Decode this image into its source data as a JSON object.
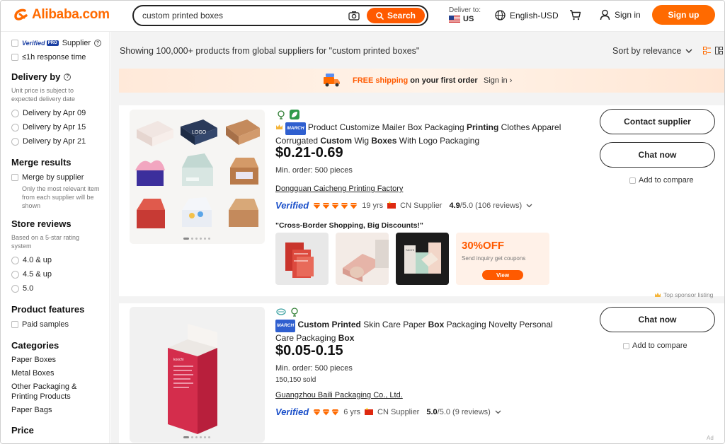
{
  "header": {
    "logo_text": "Alibaba.com",
    "search_value": "custom printed boxes",
    "search_button": "Search",
    "deliver_label": "Deliver to:",
    "deliver_country": "US",
    "language": "English-USD",
    "signin": "Sign in",
    "signup": "Sign up"
  },
  "sidebar": {
    "verified_pro_label": "Verified",
    "verified_pro_badge": "PRO",
    "verified_pro_text": "Supplier",
    "response_time": "≤1h response time",
    "delivery_title": "Delivery by",
    "delivery_note": "Unit price is subject to expected delivery date",
    "delivery_options": [
      "Delivery by Apr 09",
      "Delivery by Apr 15",
      "Delivery by Apr 21"
    ],
    "merge_title": "Merge results",
    "merge_option": "Merge by supplier",
    "merge_note": "Only the most relevant item from each supplier will be shown",
    "reviews_title": "Store reviews",
    "reviews_note": "Based on a 5-star rating system",
    "review_options": [
      "4.0 & up",
      "4.5 & up",
      "5.0"
    ],
    "features_title": "Product features",
    "features_option": "Paid samples",
    "categories_title": "Categories",
    "categories": [
      "Paper Boxes",
      "Metal Boxes",
      "Other Packaging & Printing Products",
      "Paper Bags"
    ],
    "price_title": "Price"
  },
  "main": {
    "results_text": "Showing 100,000+ products from global suppliers for \"custom printed boxes\"",
    "sort_label": "Sort by relevance",
    "banner_free": "FREE shipping",
    "banner_rest": " on your first order",
    "banner_signin": "Sign in ›",
    "sponsor_label": "Top sponsor listing",
    "ad_label": "Ad"
  },
  "products": [
    {
      "march": "MARCH",
      "title_parts": [
        " Product Customize Mailer Box Packaging ",
        "Printing",
        " Clothes Apparel Corrugated ",
        "Custom",
        " Wig ",
        "Boxes",
        " With Logo Packaging"
      ],
      "price": "$0.21-0.69",
      "moq": "Min. order: 500 pieces",
      "supplier": "Dongguan Caicheng Printing Factory",
      "verified": "Verified",
      "years": "19 yrs",
      "country": "CN Supplier",
      "rating": "4.9",
      "rating_rest": "/5.0 (106 reviews)",
      "tagline": "\"Cross-Border Shopping, Big Discounts!\"",
      "coupon_pct": "30%OFF",
      "coupon_note": "Send inquiry get coupons",
      "coupon_btn": "View",
      "btn_contact": "Contact supplier",
      "btn_chat": "Chat now",
      "compare": "Add to compare",
      "diamonds": 5
    },
    {
      "march": "MARCH",
      "title_bold1": "Custom Printed",
      "title_mid": " Skin Care Paper ",
      "title_bold2": "Box",
      "title_mid2": " Packaging Novelty Personal Care Packaging ",
      "title_bold3": "Box",
      "price": "$0.05-0.15",
      "moq": "Min. order: 500 pieces",
      "sold": "150,150 sold",
      "supplier": "Guangzhou Baili Packaging Co., Ltd.",
      "verified": "Verified",
      "years": "6 yrs",
      "country": "CN Supplier",
      "rating": "5.0",
      "rating_rest": "/5.0 (9 reviews)",
      "btn_chat": "Chat now",
      "compare": "Add to compare",
      "box_brand": "koochi",
      "diamonds": 3
    }
  ],
  "colors": {
    "brand": "#ff6a00",
    "verified": "#1a4fc9"
  }
}
